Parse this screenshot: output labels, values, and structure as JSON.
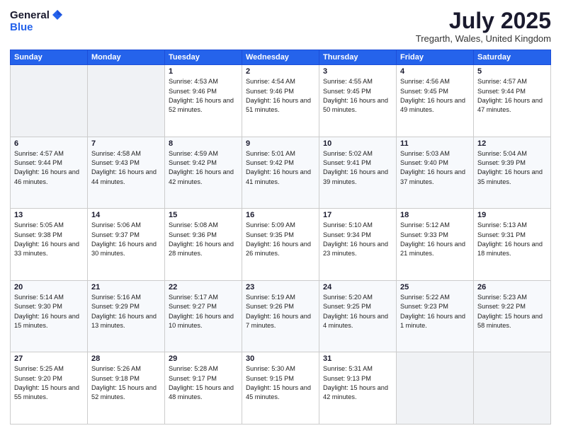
{
  "header": {
    "logo_general": "General",
    "logo_blue": "Blue",
    "title": "July 2025",
    "location": "Tregarth, Wales, United Kingdom"
  },
  "days_of_week": [
    "Sunday",
    "Monday",
    "Tuesday",
    "Wednesday",
    "Thursday",
    "Friday",
    "Saturday"
  ],
  "weeks": [
    [
      {
        "day": "",
        "sunrise": "",
        "sunset": "",
        "daylight": ""
      },
      {
        "day": "",
        "sunrise": "",
        "sunset": "",
        "daylight": ""
      },
      {
        "day": "1",
        "sunrise": "Sunrise: 4:53 AM",
        "sunset": "Sunset: 9:46 PM",
        "daylight": "Daylight: 16 hours and 52 minutes."
      },
      {
        "day": "2",
        "sunrise": "Sunrise: 4:54 AM",
        "sunset": "Sunset: 9:46 PM",
        "daylight": "Daylight: 16 hours and 51 minutes."
      },
      {
        "day": "3",
        "sunrise": "Sunrise: 4:55 AM",
        "sunset": "Sunset: 9:45 PM",
        "daylight": "Daylight: 16 hours and 50 minutes."
      },
      {
        "day": "4",
        "sunrise": "Sunrise: 4:56 AM",
        "sunset": "Sunset: 9:45 PM",
        "daylight": "Daylight: 16 hours and 49 minutes."
      },
      {
        "day": "5",
        "sunrise": "Sunrise: 4:57 AM",
        "sunset": "Sunset: 9:44 PM",
        "daylight": "Daylight: 16 hours and 47 minutes."
      }
    ],
    [
      {
        "day": "6",
        "sunrise": "Sunrise: 4:57 AM",
        "sunset": "Sunset: 9:44 PM",
        "daylight": "Daylight: 16 hours and 46 minutes."
      },
      {
        "day": "7",
        "sunrise": "Sunrise: 4:58 AM",
        "sunset": "Sunset: 9:43 PM",
        "daylight": "Daylight: 16 hours and 44 minutes."
      },
      {
        "day": "8",
        "sunrise": "Sunrise: 4:59 AM",
        "sunset": "Sunset: 9:42 PM",
        "daylight": "Daylight: 16 hours and 42 minutes."
      },
      {
        "day": "9",
        "sunrise": "Sunrise: 5:01 AM",
        "sunset": "Sunset: 9:42 PM",
        "daylight": "Daylight: 16 hours and 41 minutes."
      },
      {
        "day": "10",
        "sunrise": "Sunrise: 5:02 AM",
        "sunset": "Sunset: 9:41 PM",
        "daylight": "Daylight: 16 hours and 39 minutes."
      },
      {
        "day": "11",
        "sunrise": "Sunrise: 5:03 AM",
        "sunset": "Sunset: 9:40 PM",
        "daylight": "Daylight: 16 hours and 37 minutes."
      },
      {
        "day": "12",
        "sunrise": "Sunrise: 5:04 AM",
        "sunset": "Sunset: 9:39 PM",
        "daylight": "Daylight: 16 hours and 35 minutes."
      }
    ],
    [
      {
        "day": "13",
        "sunrise": "Sunrise: 5:05 AM",
        "sunset": "Sunset: 9:38 PM",
        "daylight": "Daylight: 16 hours and 33 minutes."
      },
      {
        "day": "14",
        "sunrise": "Sunrise: 5:06 AM",
        "sunset": "Sunset: 9:37 PM",
        "daylight": "Daylight: 16 hours and 30 minutes."
      },
      {
        "day": "15",
        "sunrise": "Sunrise: 5:08 AM",
        "sunset": "Sunset: 9:36 PM",
        "daylight": "Daylight: 16 hours and 28 minutes."
      },
      {
        "day": "16",
        "sunrise": "Sunrise: 5:09 AM",
        "sunset": "Sunset: 9:35 PM",
        "daylight": "Daylight: 16 hours and 26 minutes."
      },
      {
        "day": "17",
        "sunrise": "Sunrise: 5:10 AM",
        "sunset": "Sunset: 9:34 PM",
        "daylight": "Daylight: 16 hours and 23 minutes."
      },
      {
        "day": "18",
        "sunrise": "Sunrise: 5:12 AM",
        "sunset": "Sunset: 9:33 PM",
        "daylight": "Daylight: 16 hours and 21 minutes."
      },
      {
        "day": "19",
        "sunrise": "Sunrise: 5:13 AM",
        "sunset": "Sunset: 9:31 PM",
        "daylight": "Daylight: 16 hours and 18 minutes."
      }
    ],
    [
      {
        "day": "20",
        "sunrise": "Sunrise: 5:14 AM",
        "sunset": "Sunset: 9:30 PM",
        "daylight": "Daylight: 16 hours and 15 minutes."
      },
      {
        "day": "21",
        "sunrise": "Sunrise: 5:16 AM",
        "sunset": "Sunset: 9:29 PM",
        "daylight": "Daylight: 16 hours and 13 minutes."
      },
      {
        "day": "22",
        "sunrise": "Sunrise: 5:17 AM",
        "sunset": "Sunset: 9:27 PM",
        "daylight": "Daylight: 16 hours and 10 minutes."
      },
      {
        "day": "23",
        "sunrise": "Sunrise: 5:19 AM",
        "sunset": "Sunset: 9:26 PM",
        "daylight": "Daylight: 16 hours and 7 minutes."
      },
      {
        "day": "24",
        "sunrise": "Sunrise: 5:20 AM",
        "sunset": "Sunset: 9:25 PM",
        "daylight": "Daylight: 16 hours and 4 minutes."
      },
      {
        "day": "25",
        "sunrise": "Sunrise: 5:22 AM",
        "sunset": "Sunset: 9:23 PM",
        "daylight": "Daylight: 16 hours and 1 minute."
      },
      {
        "day": "26",
        "sunrise": "Sunrise: 5:23 AM",
        "sunset": "Sunset: 9:22 PM",
        "daylight": "Daylight: 15 hours and 58 minutes."
      }
    ],
    [
      {
        "day": "27",
        "sunrise": "Sunrise: 5:25 AM",
        "sunset": "Sunset: 9:20 PM",
        "daylight": "Daylight: 15 hours and 55 minutes."
      },
      {
        "day": "28",
        "sunrise": "Sunrise: 5:26 AM",
        "sunset": "Sunset: 9:18 PM",
        "daylight": "Daylight: 15 hours and 52 minutes."
      },
      {
        "day": "29",
        "sunrise": "Sunrise: 5:28 AM",
        "sunset": "Sunset: 9:17 PM",
        "daylight": "Daylight: 15 hours and 48 minutes."
      },
      {
        "day": "30",
        "sunrise": "Sunrise: 5:30 AM",
        "sunset": "Sunset: 9:15 PM",
        "daylight": "Daylight: 15 hours and 45 minutes."
      },
      {
        "day": "31",
        "sunrise": "Sunrise: 5:31 AM",
        "sunset": "Sunset: 9:13 PM",
        "daylight": "Daylight: 15 hours and 42 minutes."
      },
      {
        "day": "",
        "sunrise": "",
        "sunset": "",
        "daylight": ""
      },
      {
        "day": "",
        "sunrise": "",
        "sunset": "",
        "daylight": ""
      }
    ]
  ]
}
